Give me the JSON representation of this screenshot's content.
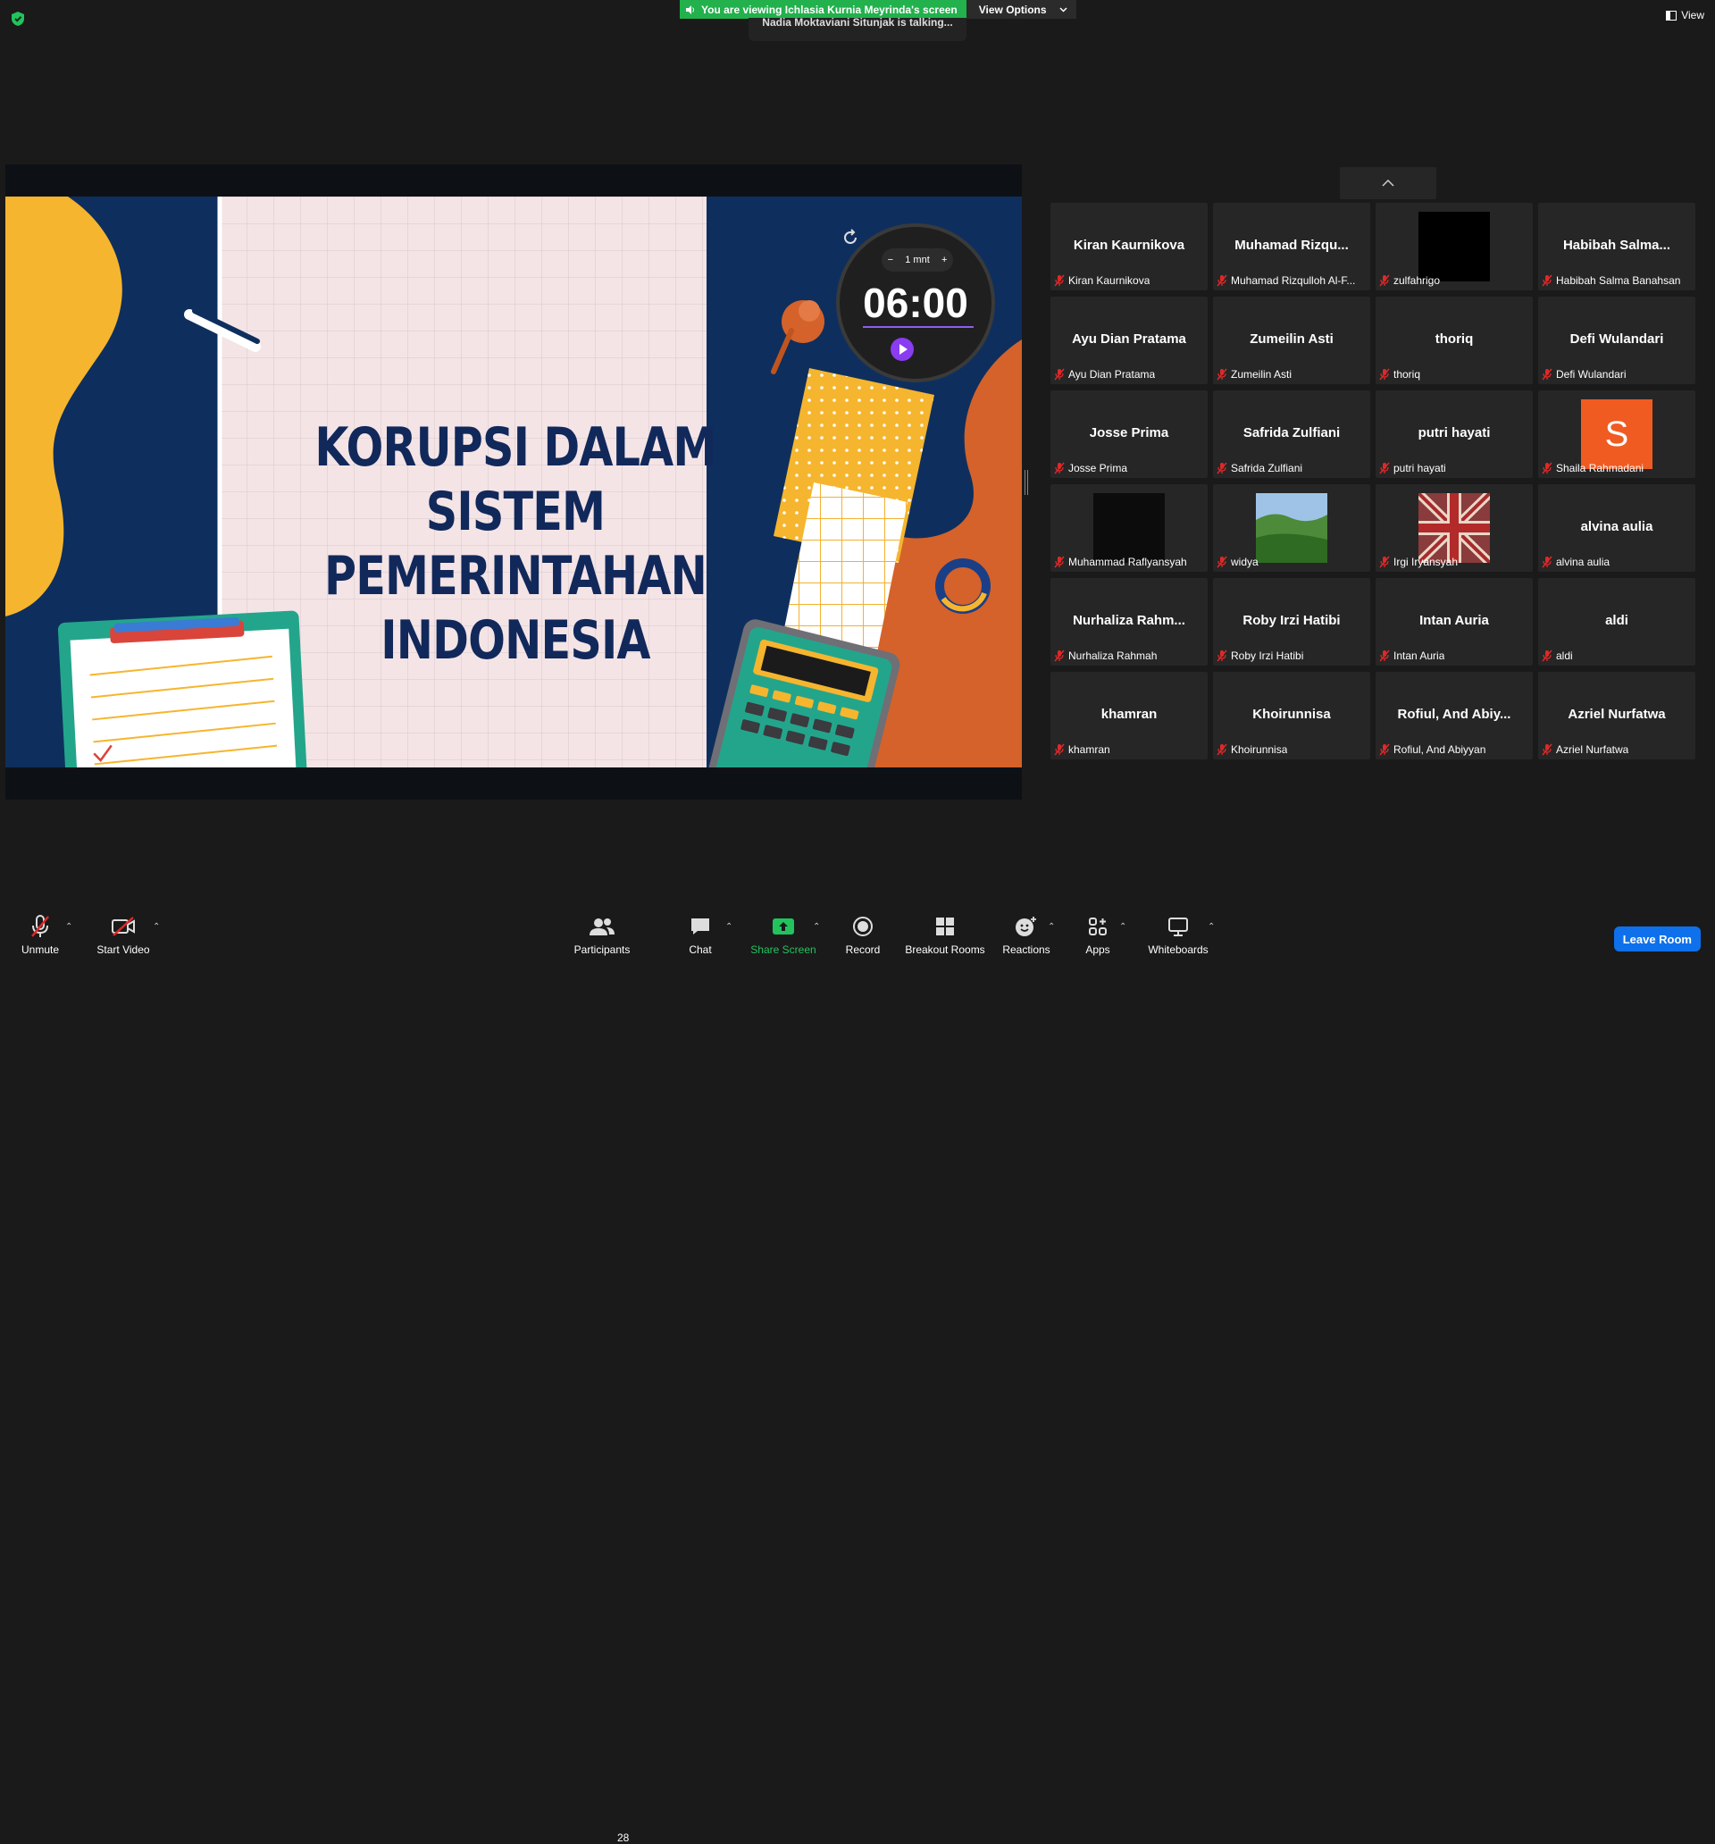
{
  "banner": {
    "viewing_text": "You are viewing Ichlasia Kurnia Meyrinda's screen",
    "view_options_label": "View Options",
    "talking_text": "Nadia Moktaviani Situnjak is talking...",
    "view_label": "View"
  },
  "slide": {
    "title_line1": "KORUPSI DALAM SISTEM",
    "title_line2": "PEMERINTAHAN INDONESIA",
    "timer_minus": "−",
    "timer_step": "1 mnt",
    "timer_plus": "+",
    "timer_value": "06:00"
  },
  "participants": [
    {
      "name": "Kiran Kaurnikova",
      "label": "Kiran Kaurnikova",
      "video": "none"
    },
    {
      "name": "Muhamad  Rizqu...",
      "label": "Muhamad Rizqulloh Al-F...",
      "video": "none"
    },
    {
      "name": "",
      "label": "zulfahrigo",
      "video": "black"
    },
    {
      "name": "Habibah  Salma...",
      "label": "Habibah Salma Banahsan",
      "video": "none"
    },
    {
      "name": "Ayu Dian Pratama",
      "label": "Ayu Dian Pratama",
      "video": "none"
    },
    {
      "name": "Zumeilin Asti",
      "label": "Zumeilin Asti",
      "video": "none"
    },
    {
      "name": "thoriq",
      "label": "thoriq",
      "video": "none"
    },
    {
      "name": "Defi Wulandari",
      "label": "Defi Wulandari",
      "video": "none"
    },
    {
      "name": "Josse Prima",
      "label": "Josse Prima",
      "video": "none"
    },
    {
      "name": "Safrida Zulfiani",
      "label": "Safrida Zulfiani",
      "video": "none"
    },
    {
      "name": "putri hayati",
      "label": "putri hayati",
      "video": "none"
    },
    {
      "name": "",
      "label": "Shaila Rahmadani",
      "video": "avatar",
      "initial": "S"
    },
    {
      "name": "",
      "label": "Muhammad Raflyansyah",
      "video": "dark"
    },
    {
      "name": "",
      "label": "widya",
      "video": "landscape"
    },
    {
      "name": "",
      "label": "Irgi Iryansyah",
      "video": "flag"
    },
    {
      "name": "alvina aulia",
      "label": "alvina aulia",
      "video": "none"
    },
    {
      "name": "Nurhaliza  Rahm...",
      "label": "Nurhaliza Rahmah",
      "video": "none"
    },
    {
      "name": "Roby Irzi Hatibi",
      "label": "Roby Irzi Hatibi",
      "video": "none"
    },
    {
      "name": "Intan Auria",
      "label": "Intan Auria",
      "video": "none"
    },
    {
      "name": "aldi",
      "label": "aldi",
      "video": "none"
    },
    {
      "name": "khamran",
      "label": "khamran",
      "video": "none"
    },
    {
      "name": "Khoirunnisa",
      "label": "Khoirunnisa",
      "video": "none"
    },
    {
      "name": "Rofiul,  And Abiy...",
      "label": "Rofiul, And Abiyyan",
      "video": "none"
    },
    {
      "name": "Azriel Nurfatwa",
      "label": "Azriel Nurfatwa",
      "video": "none"
    }
  ],
  "toolbar": {
    "unmute": "Unmute",
    "start_video": "Start Video",
    "participants": "Participants",
    "participants_count": "28",
    "chat": "Chat",
    "share_screen": "Share Screen",
    "record": "Record",
    "breakout_rooms": "Breakout Rooms",
    "reactions": "Reactions",
    "apps": "Apps",
    "whiteboards": "Whiteboards",
    "leave_room": "Leave Room"
  },
  "colors": {
    "accent_green": "#22b14c",
    "leave_blue": "#0e71eb",
    "muted_red": "#e02828",
    "tile_bg": "#262626"
  }
}
